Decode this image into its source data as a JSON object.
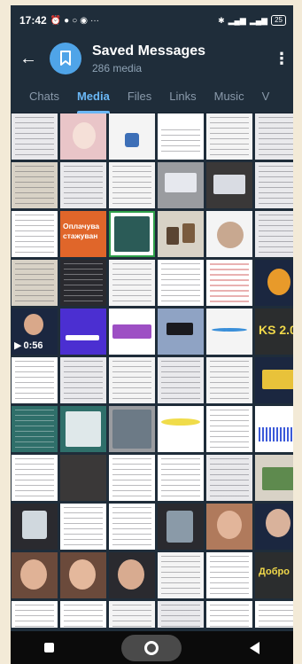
{
  "statusbar": {
    "time": "17:42",
    "dots": "···",
    "battery": "25"
  },
  "header": {
    "title": "Saved Messages",
    "subtitle": "286 media"
  },
  "tabs": [
    {
      "label": "Chats",
      "active": false
    },
    {
      "label": "Media",
      "active": true
    },
    {
      "label": "Files",
      "active": false
    },
    {
      "label": "Links",
      "active": false
    },
    {
      "label": "Music",
      "active": false
    },
    {
      "label": "V",
      "active": false
    }
  ],
  "tiles": {
    "orange_text": "Оплачува стажуван",
    "video_duration": "0:56",
    "ks_text": "KS 2.0",
    "dobro_text": "Добро"
  },
  "colors": {
    "accent": "#6ab7f5",
    "background": "#1f2d3a",
    "avatar": "#4fa4e8"
  }
}
